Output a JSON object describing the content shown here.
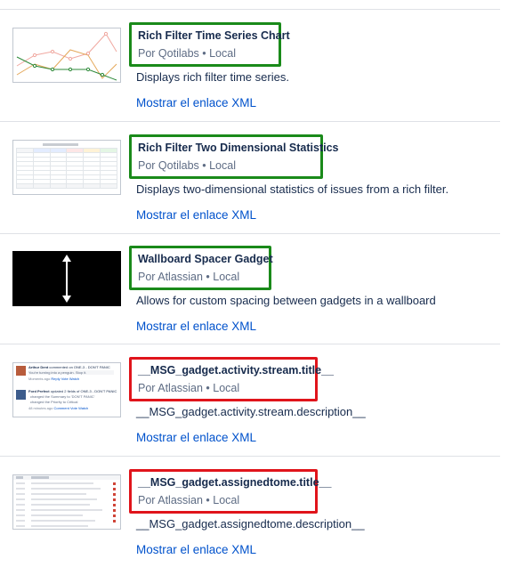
{
  "colors": {
    "highlight_ok": "#1a8a1a",
    "highlight_bad": "#e0141b",
    "link": "#0052cc"
  },
  "gadgets": [
    {
      "title": "Rich Filter Time Series Chart",
      "meta": "Por Qotilabs • Local",
      "description": "Displays rich filter time series.",
      "link_label": "Mostrar el enlace XML",
      "thumbnail": "line-chart-thumbnail"
    },
    {
      "title": "Rich Filter Two Dimensional Statistics",
      "meta": "Por Qotilabs • Local",
      "description": "Displays two-dimensional statistics of issues from a rich filter.",
      "link_label": "Mostrar el enlace XML",
      "thumbnail": "stats-table-thumbnail"
    },
    {
      "title": "Wallboard Spacer Gadget",
      "meta": "Por Atlassian • Local",
      "description": "Allows for custom spacing between gadgets in a wallboard",
      "link_label": "Mostrar el enlace XML",
      "thumbnail": "vertical-arrow-thumbnail"
    },
    {
      "title": "__MSG_gadget.activity.stream.title__",
      "meta": "Por Atlassian • Local",
      "description": "__MSG_gadget.activity.stream.description__",
      "link_label": "Mostrar el enlace XML",
      "thumbnail": "activity-stream-thumbnail",
      "thumb_text": {
        "user1": "Arthur Dent",
        "action1": "commented on ONE-3 - DON'T PANIC",
        "quote1": "You're turning into a penguin. Stop it.",
        "time1": "Moments ago",
        "reply": "Reply",
        "vote": "Vote",
        "watch": "Watch",
        "user2": "Ford Prefect",
        "action2": "updated 2 fields of ONE-3 - DON'T PANIC",
        "change1": "changed the Summary to 'DON'T PANIC'",
        "change2": "changed the Priority to Critical",
        "time2": "48 minutes ago",
        "comment": "Comment"
      }
    },
    {
      "title": "__MSG_gadget.assignedtome.title__",
      "meta": "Por Atlassian • Local",
      "description": "__MSG_gadget.assignedtome.description__",
      "link_label": "Mostrar el enlace XML",
      "thumbnail": "assigned-list-thumbnail"
    }
  ]
}
